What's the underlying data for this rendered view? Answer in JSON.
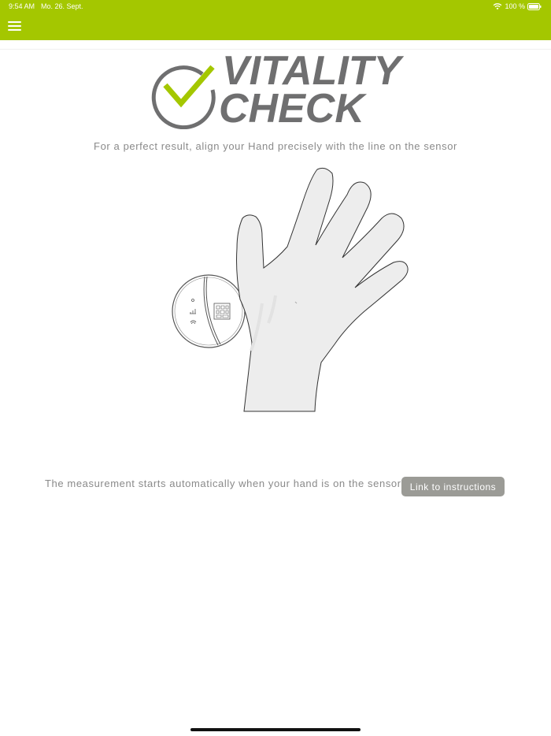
{
  "status_bar": {
    "time": "9:54 AM",
    "date": "Mo. 26. Sept.",
    "battery": "100 %",
    "icons": [
      "wifi-icon",
      "battery-icon"
    ]
  },
  "header": {
    "menu_icon": "hamburger-menu-icon",
    "background_color": "#a4c700"
  },
  "logo": {
    "line1": "VITALITY",
    "line2": "CHECK",
    "checkmark_color": "#a4c700",
    "text_color": "#6f6f70"
  },
  "main": {
    "instruction": "For a perfect result, align your Hand precisely with the line on the sensor",
    "measurement_text": "The measurement starts automatically when your hand is on the sensor.",
    "instructions_button": "Link to instructions"
  }
}
